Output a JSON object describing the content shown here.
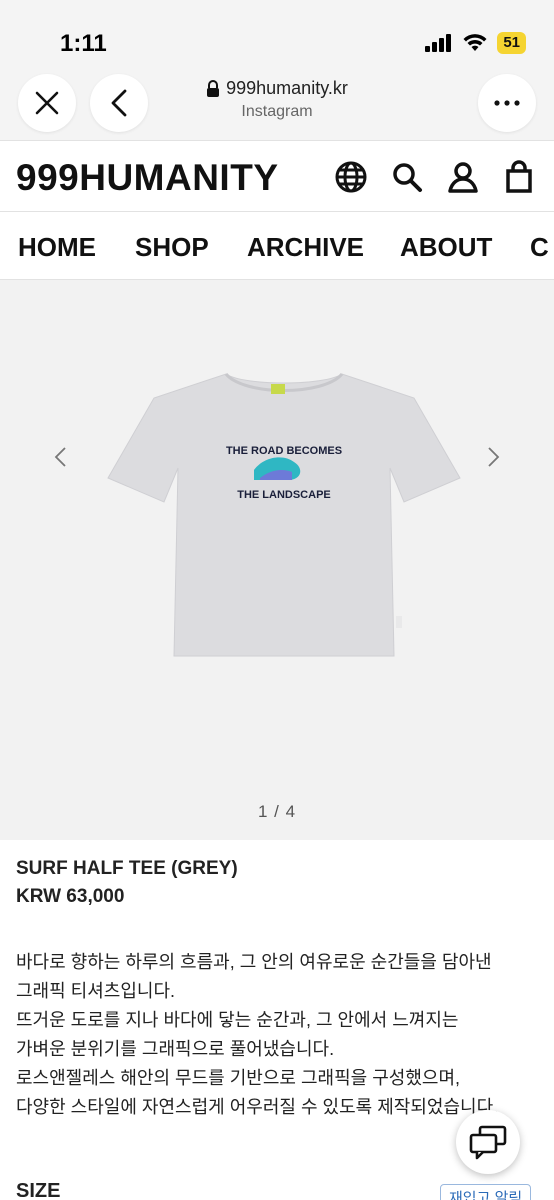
{
  "status_bar": {
    "time": "1:11",
    "battery": "51"
  },
  "browser": {
    "url": "999humanity.kr",
    "source": "Instagram"
  },
  "site": {
    "logo": "999HUMANITY",
    "nav": [
      "HOME",
      "SHOP",
      "ARCHIVE",
      "ABOUT",
      "C"
    ]
  },
  "gallery": {
    "counter": "1 / 4",
    "print_line1": "THE ROAD BECOMES",
    "print_line2": "THE LANDSCAPE",
    "shirt_color": "#dcdcdf"
  },
  "product": {
    "name": "SURF HALF TEE (GREY)",
    "price": "KRW 63,000",
    "description": [
      "바다로 향하는 하루의 흐름과, 그 안의 여유로운 순간들을 담아낸",
      "그래픽 티셔츠입니다.",
      "뜨거운 도로를 지나 바다에 닿는 순간과, 그 안에서 느껴지는",
      "가벼운 분위기를 그래픽으로 풀어냈습니다.",
      "로스앤젤레스 해안의 무드를 기반으로 그래픽을 구성했으며,",
      "다양한 스타일에 자연스럽게 어우러질 수 있도록 제작되었습니다."
    ],
    "size_label": "SIZE",
    "restock_label": "재입고 알림"
  },
  "icons": {
    "close": "close-icon",
    "back": "chevron-left-icon",
    "more": "more-icon",
    "lock": "lock-icon",
    "globe": "globe-icon",
    "search": "search-icon",
    "user": "user-icon",
    "bag": "bag-icon",
    "chat": "chat-icon"
  }
}
